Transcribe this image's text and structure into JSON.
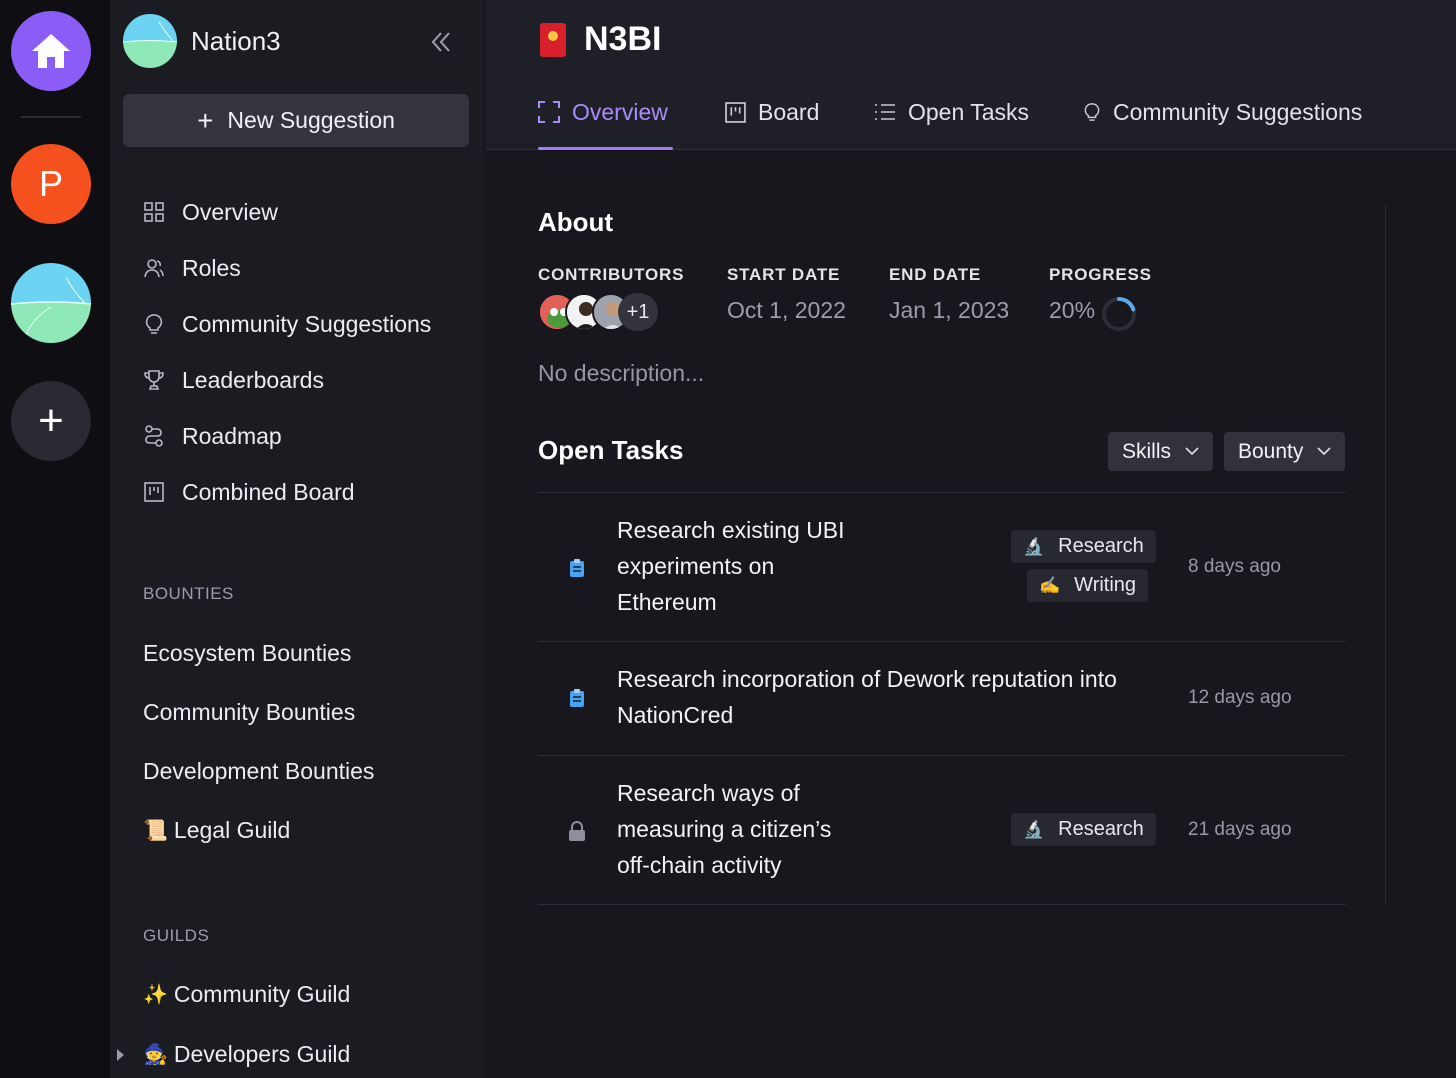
{
  "rail": {
    "workspace_initial": "P",
    "add_label": "+"
  },
  "sidebar": {
    "workspace_name": "Nation3",
    "new_suggestion_label": "New Suggestion",
    "nav": [
      {
        "label": "Overview",
        "icon": "grid-icon"
      },
      {
        "label": "Roles",
        "icon": "users-icon"
      },
      {
        "label": "Community Suggestions",
        "icon": "lightbulb-icon"
      },
      {
        "label": "Leaderboards",
        "icon": "trophy-icon"
      },
      {
        "label": "Roadmap",
        "icon": "route-icon"
      },
      {
        "label": "Combined Board",
        "icon": "board-icon"
      }
    ],
    "bounties_title": "BOUNTIES",
    "bounties": [
      {
        "label": "Ecosystem Bounties"
      },
      {
        "label": "Community Bounties"
      },
      {
        "label": "Development Bounties"
      },
      {
        "label": "Legal Guild",
        "emoji": "📜"
      }
    ],
    "guilds_title": "GUILDS",
    "guilds": [
      {
        "label": "Community Guild",
        "emoji": "✨"
      },
      {
        "label": "Developers Guild",
        "emoji": "🧙"
      }
    ]
  },
  "header": {
    "project_title": "N3BI",
    "tabs": [
      {
        "label": "Overview",
        "icon": "focus-icon",
        "active": true
      },
      {
        "label": "Board",
        "icon": "board-icon"
      },
      {
        "label": "Open Tasks",
        "icon": "list-icon"
      },
      {
        "label": "Community Suggestions",
        "icon": "lightbulb-icon"
      }
    ]
  },
  "about": {
    "title": "About",
    "contributors_label": "CONTRIBUTORS",
    "contributors_more": "+1",
    "start_label": "START DATE",
    "start_value": "Oct 1, 2022",
    "end_label": "END DATE",
    "end_value": "Jan 1, 2023",
    "progress_label": "PROGRESS",
    "progress_value": "20%",
    "progress_fraction": 0.2,
    "description": "No description..."
  },
  "tasks": {
    "title": "Open Tasks",
    "filters": [
      "Skills",
      "Bounty"
    ],
    "items": [
      {
        "title_lines": [
          "Research existing UBI",
          "experiments on",
          "Ethereum"
        ],
        "tags": [
          {
            "emoji": "🔬",
            "label": "Research"
          },
          {
            "emoji": "✍️",
            "label": "Writing"
          }
        ],
        "time": "8 days ago",
        "icon": "clipboard-icon"
      },
      {
        "title_lines": [
          "Research incorporation of Dework reputation into",
          "NationCred"
        ],
        "tags": [],
        "time": "12 days ago",
        "icon": "clipboard-icon"
      },
      {
        "title_lines": [
          "Research ways of",
          "measuring a citizen’s",
          "off-chain activity"
        ],
        "tags": [
          {
            "emoji": "🔬",
            "label": "Research"
          }
        ],
        "time": "21 days ago",
        "icon": "lock-icon"
      }
    ]
  },
  "colors": {
    "accent": "#9f7dfa",
    "home": "#8b5cf6",
    "workspace_p": "#f4511e",
    "progress_arc": "#5aa9e6"
  }
}
